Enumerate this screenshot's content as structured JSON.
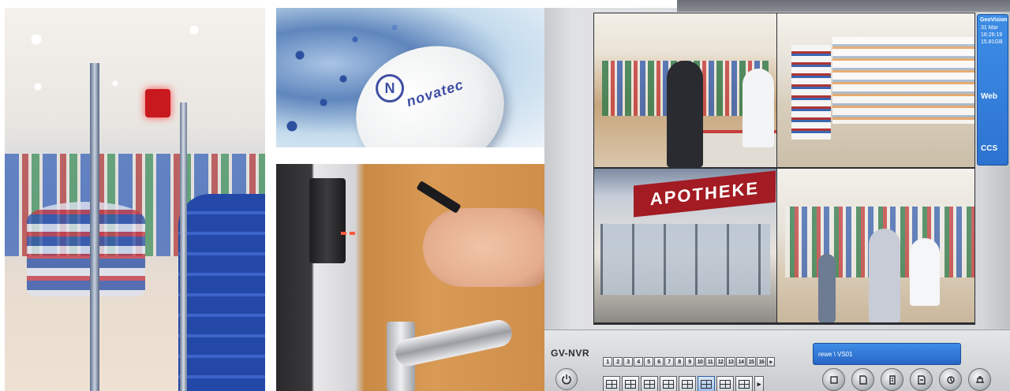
{
  "photos": {
    "tablet": {
      "brand_text": "novatec"
    },
    "apotheke_sign": "APOTHEKE"
  },
  "app": {
    "logo": "GV-NVR",
    "side_panel": {
      "brand": "GeoVision",
      "date": "31 Mar",
      "time": "16:26:19",
      "disk": "15.81GB",
      "web_label": "Web",
      "ccs_label": "CCS"
    },
    "status_text": "rewe \\ VS01",
    "channels": [
      "1",
      "2",
      "3",
      "4",
      "5",
      "6",
      "7",
      "8",
      "9",
      "10",
      "11",
      "12",
      "13",
      "14",
      "15",
      "16"
    ],
    "channel_next": "▸",
    "layout_next": "▸",
    "layout_active_index": 5,
    "tools": [
      "tool-1-icon",
      "tool-2-icon",
      "tool-3-icon",
      "tool-4-icon",
      "tool-5-icon",
      "tool-6-icon"
    ],
    "colors": {
      "accent_blue": "#2c73d0",
      "apotheke_red": "#a31b23"
    }
  }
}
